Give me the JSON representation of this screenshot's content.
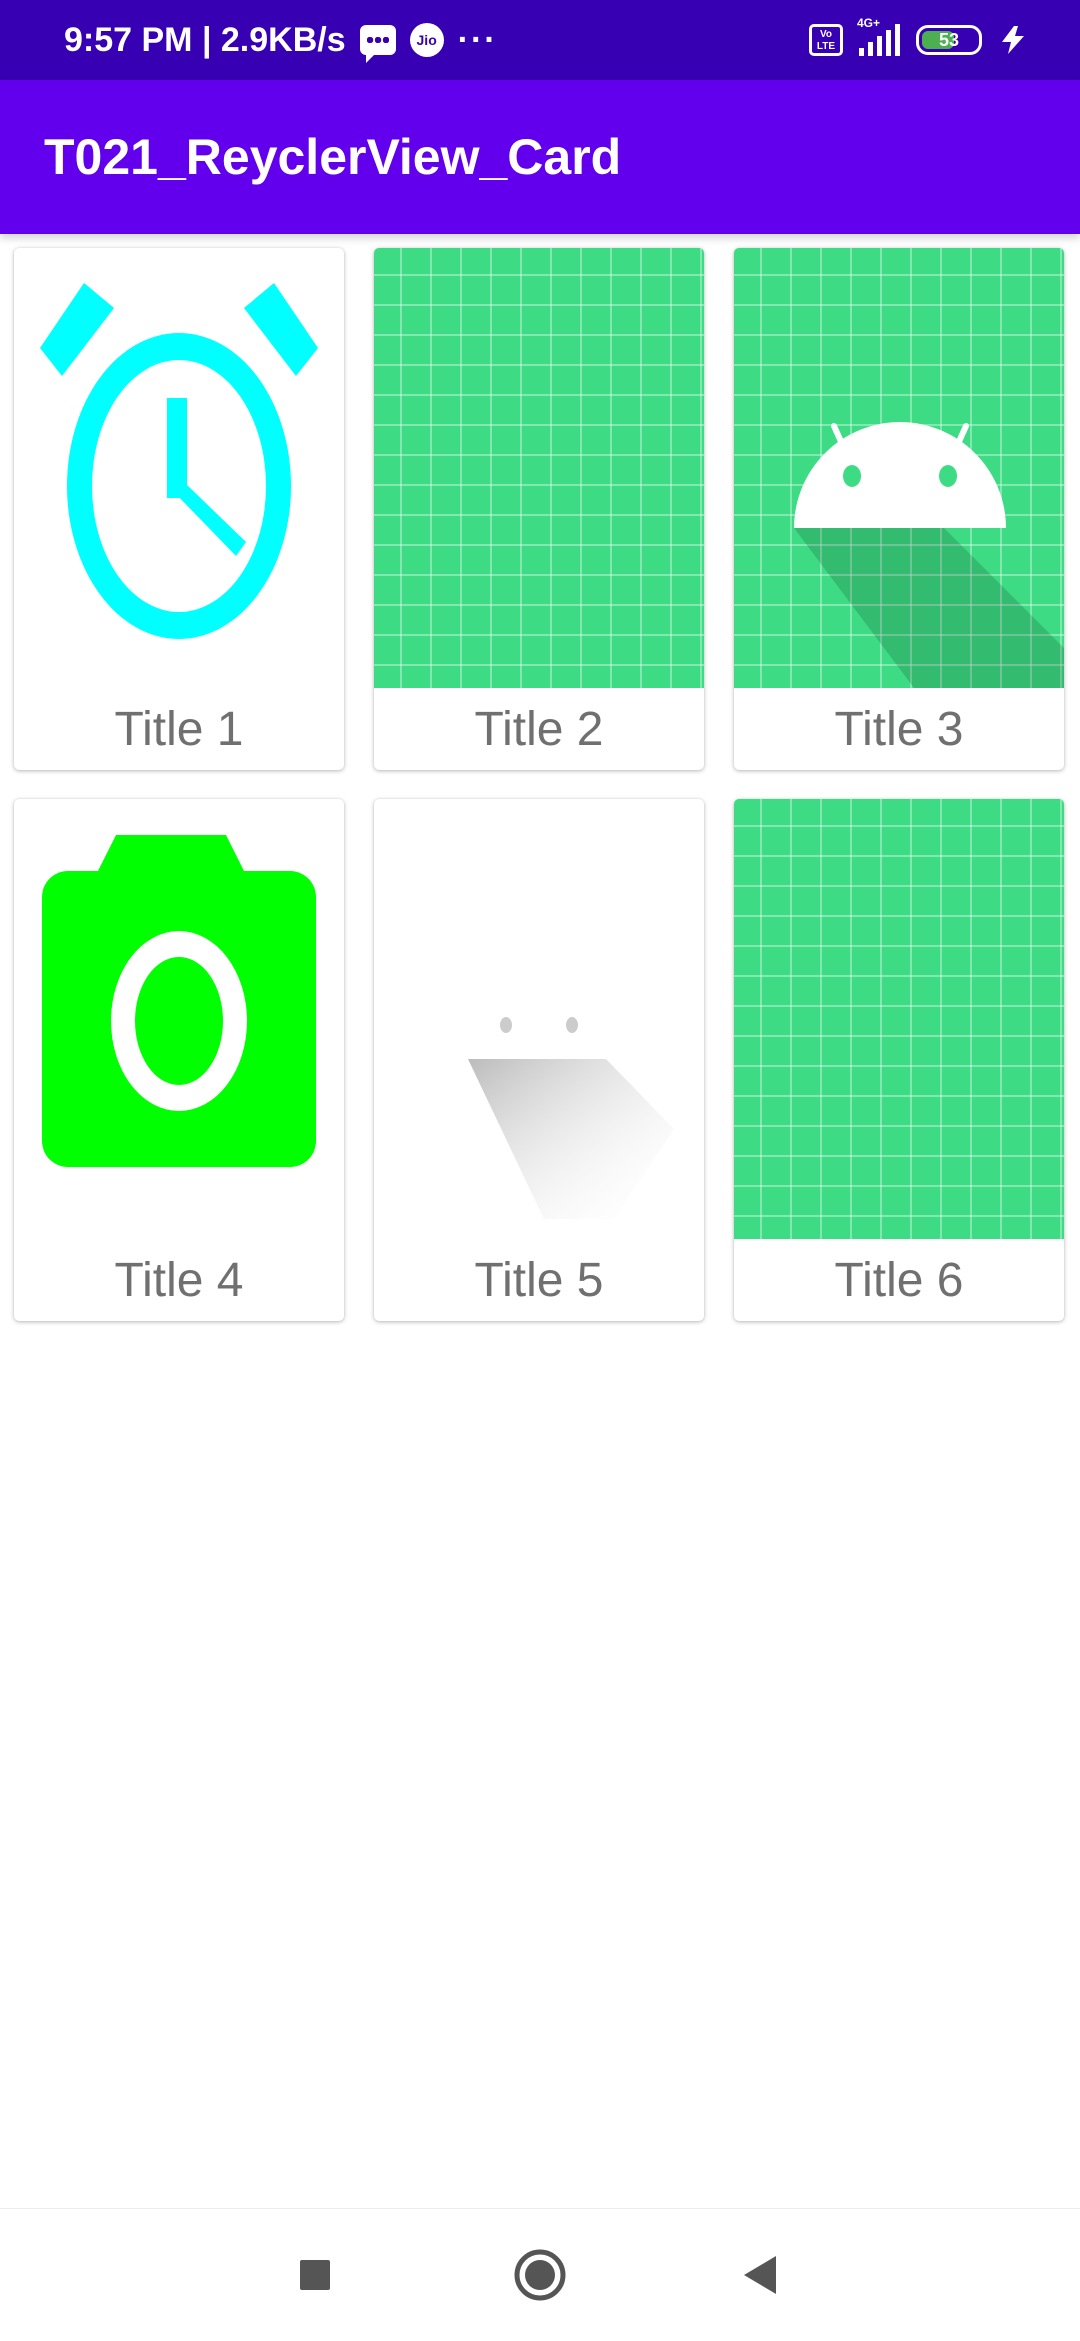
{
  "status_bar": {
    "time_speed": "9:57 PM | 2.9KB/s",
    "carrier_icon_text": "Jio",
    "more": "···",
    "volte": "Vo LTE",
    "network": "4G+",
    "battery": "53"
  },
  "app_bar": {
    "title": "T021_ReyclerView_Card"
  },
  "cards": [
    {
      "title": "Title 1",
      "image": "alarm-clock-icon",
      "color": "#00ffff"
    },
    {
      "title": "Title 2",
      "image": "android-background-grid",
      "color": "#3ddc84"
    },
    {
      "title": "Title 3",
      "image": "android-launcher-icon",
      "color": "#3ddc84"
    },
    {
      "title": "Title 4",
      "image": "camera-icon",
      "color": "#00ff00"
    },
    {
      "title": "Title 5",
      "image": "android-foreground-icon",
      "color": "#ffffff"
    },
    {
      "title": "Title 6",
      "image": "android-background-grid",
      "color": "#3ddc84"
    }
  ],
  "nav_bar": {
    "recent": "recent-apps-icon",
    "home": "home-icon",
    "back": "back-icon"
  },
  "colors": {
    "status_bar": "#3700b3",
    "app_bar": "#6200ee",
    "title_text": "#707070"
  }
}
